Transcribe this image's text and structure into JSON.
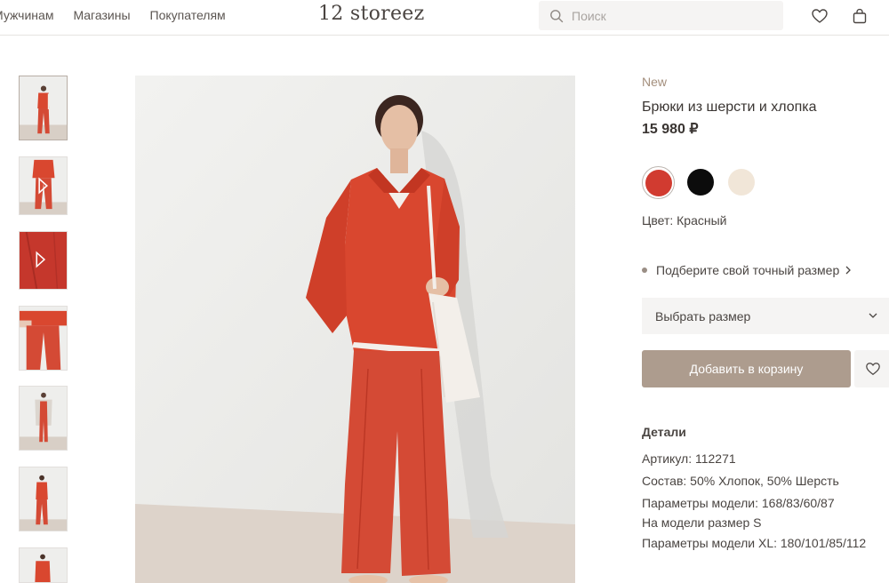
{
  "header": {
    "nav": [
      "Мужчинам",
      "Магазины",
      "Покупателям"
    ],
    "logo": "12 storeez",
    "search_placeholder": "Поиск"
  },
  "gallery": {
    "thumbnails": [
      {
        "kind": "photo",
        "active": true
      },
      {
        "kind": "video",
        "active": false
      },
      {
        "kind": "video",
        "active": false
      },
      {
        "kind": "photo",
        "active": false
      },
      {
        "kind": "photo",
        "active": false
      },
      {
        "kind": "photo",
        "active": false
      },
      {
        "kind": "photo",
        "active": false
      }
    ]
  },
  "product": {
    "badge": "New",
    "title": "Брюки из шерсти и хлопка",
    "price": "15 980 ₽",
    "colors": [
      {
        "name": "red",
        "hex": "#d13b30",
        "selected": true
      },
      {
        "name": "black",
        "hex": "#0c0c0c",
        "selected": false
      },
      {
        "name": "cream",
        "hex": "#f1e6d8",
        "selected": false
      }
    ],
    "color_label": "Цвет: Красный",
    "size_guide": "Подберите свой точный размер",
    "size_select": "Выбрать размер",
    "add_to_cart": "Добавить в корзину"
  },
  "details": {
    "title": "Детали",
    "lines": [
      "Артикул: 112271",
      "Состав: 50% Хлопок, 50% Шерсть",
      "Параметры модели: 168/83/60/87",
      "На модели размер S",
      "Параметры модели XL: 180/101/85/112"
    ]
  },
  "colors": {
    "accent": "#ad9c8e",
    "badge": "#a48f7d",
    "garment": "#d9472f",
    "search_bg": "#f5f4f3"
  }
}
